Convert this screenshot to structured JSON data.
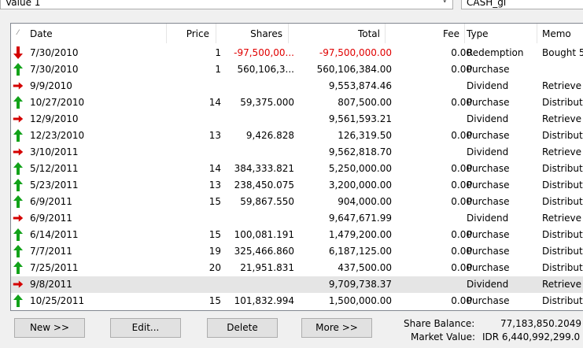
{
  "filters": {
    "left_value": "Value 1",
    "right_value": "CASH_gl"
  },
  "columns": [
    "Date",
    "Price",
    "Shares",
    "Total",
    "Fee",
    "Type",
    "Memo"
  ],
  "rows": [
    {
      "dir": "down",
      "date": "7/30/2010",
      "price": "1",
      "shares": "-97,500,00...",
      "total": "-97,500,000.00",
      "fee": "0.00",
      "type": "Redemption",
      "memo": "Bought 5",
      "neg": true
    },
    {
      "dir": "up",
      "date": "7/30/2010",
      "price": "1",
      "shares": "560,106,3...",
      "total": "560,106,384.00",
      "fee": "0.00",
      "type": "Purchase",
      "memo": ""
    },
    {
      "dir": "right",
      "date": "9/9/2010",
      "price": "",
      "shares": "",
      "total": "9,553,874.46",
      "fee": "",
      "type": "Dividend",
      "memo": "Retrieve"
    },
    {
      "dir": "up",
      "date": "10/27/2010",
      "price": "14",
      "shares": "59,375.000",
      "total": "807,500.00",
      "fee": "0.00",
      "type": "Purchase",
      "memo": "Distribute"
    },
    {
      "dir": "right",
      "date": "12/9/2010",
      "price": "",
      "shares": "",
      "total": "9,561,593.21",
      "fee": "",
      "type": "Dividend",
      "memo": "Retrieve"
    },
    {
      "dir": "up",
      "date": "12/23/2010",
      "price": "13",
      "shares": "9,426.828",
      "total": "126,319.50",
      "fee": "0.00",
      "type": "Purchase",
      "memo": "Distribute"
    },
    {
      "dir": "right",
      "date": "3/10/2011",
      "price": "",
      "shares": "",
      "total": "9,562,818.70",
      "fee": "",
      "type": "Dividend",
      "memo": "Retrieve"
    },
    {
      "dir": "up",
      "date": "5/12/2011",
      "price": "14",
      "shares": "384,333.821",
      "total": "5,250,000.00",
      "fee": "0.00",
      "type": "Purchase",
      "memo": "Distribute"
    },
    {
      "dir": "up",
      "date": "5/23/2011",
      "price": "13",
      "shares": "238,450.075",
      "total": "3,200,000.00",
      "fee": "0.00",
      "type": "Purchase",
      "memo": "Distribute"
    },
    {
      "dir": "up",
      "date": "6/9/2011",
      "price": "15",
      "shares": "59,867.550",
      "total": "904,000.00",
      "fee": "0.00",
      "type": "Purchase",
      "memo": "Distribute"
    },
    {
      "dir": "right",
      "date": "6/9/2011",
      "price": "",
      "shares": "",
      "total": "9,647,671.99",
      "fee": "",
      "type": "Dividend",
      "memo": "Retrieve"
    },
    {
      "dir": "up",
      "date": "6/14/2011",
      "price": "15",
      "shares": "100,081.191",
      "total": "1,479,200.00",
      "fee": "0.00",
      "type": "Purchase",
      "memo": "Distribute"
    },
    {
      "dir": "up",
      "date": "7/7/2011",
      "price": "19",
      "shares": "325,466.860",
      "total": "6,187,125.00",
      "fee": "0.00",
      "type": "Purchase",
      "memo": "Distribute"
    },
    {
      "dir": "up",
      "date": "7/25/2011",
      "price": "20",
      "shares": "21,951.831",
      "total": "437,500.00",
      "fee": "0.00",
      "type": "Purchase",
      "memo": "Distribute"
    },
    {
      "dir": "right",
      "date": "9/8/2011",
      "price": "",
      "shares": "",
      "total": "9,709,738.37",
      "fee": "",
      "type": "Dividend",
      "memo": "Retrieve",
      "selected": true
    },
    {
      "dir": "up",
      "date": "10/25/2011",
      "price": "15",
      "shares": "101,832.994",
      "total": "1,500,000.00",
      "fee": "0.00",
      "type": "Purchase",
      "memo": "Distribute"
    }
  ],
  "buttons": {
    "new": "New >>",
    "edit": "Edit...",
    "delete": "Delete",
    "more": "More >>"
  },
  "summary": {
    "share_balance_label": "Share Balance:",
    "share_balance_value": "77,183,850.2049",
    "market_value_label": "Market Value:",
    "market_value_value": "IDR 6,440,992,299.0"
  },
  "icons": {
    "purchase": "green-up-arrow-icon",
    "redemption": "red-down-arrow-icon",
    "dividend": "red-right-arrow-icon",
    "green": "#12a21a",
    "red": "#d40000"
  }
}
